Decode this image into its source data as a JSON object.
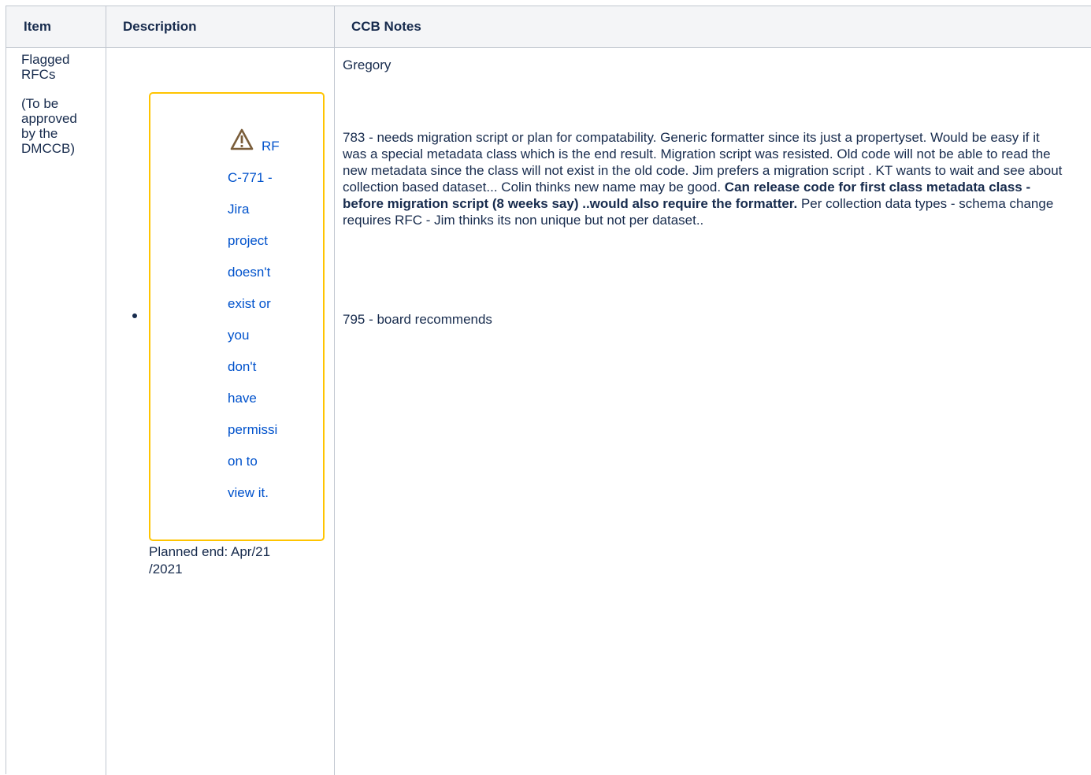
{
  "table": {
    "headers": {
      "item": "Item",
      "description": "Description",
      "notes": "CCB Notes"
    },
    "row": {
      "item_title": "Flagged RFCs",
      "item_sub": "(To be approved by the DMCCB)",
      "jira": {
        "key_part1": "RF",
        "key_part2": "C-771",
        "dash": " -",
        "message_lines": [
          "Jira",
          "project",
          "doesn't",
          "exist or",
          "you",
          "don't",
          "have",
          "permissi",
          "on to",
          "view it."
        ],
        "warning_icon": "warning-icon",
        "accent_color": "#ffc400"
      },
      "planned_end_line1": "Planned end: Apr/21",
      "planned_end_line2": "/2021",
      "notes": {
        "presenter": "Gregory",
        "note_783_start": "783 - needs migration script or plan for compatability. Generic formatter since its just a propertyset. Would be easy if it was a special metadata class which is the end result. Migration script was resisted. Old code will not be able to read the new metadata since the class will not exist in the old code. Jim prefers a migration script .  KT wants to wait and see about collection based dataset... Colin thinks new name may be good. ",
        "note_783_bold": "Can release code for first class metadata class -  before migration script (8 weeks say) ..would also require the formatter.",
        "note_783_end": " Per collection data types - schema change requires RFC - Jim thinks its non unique but not per dataset..",
        "note_795": "795 - board recommends"
      }
    }
  }
}
